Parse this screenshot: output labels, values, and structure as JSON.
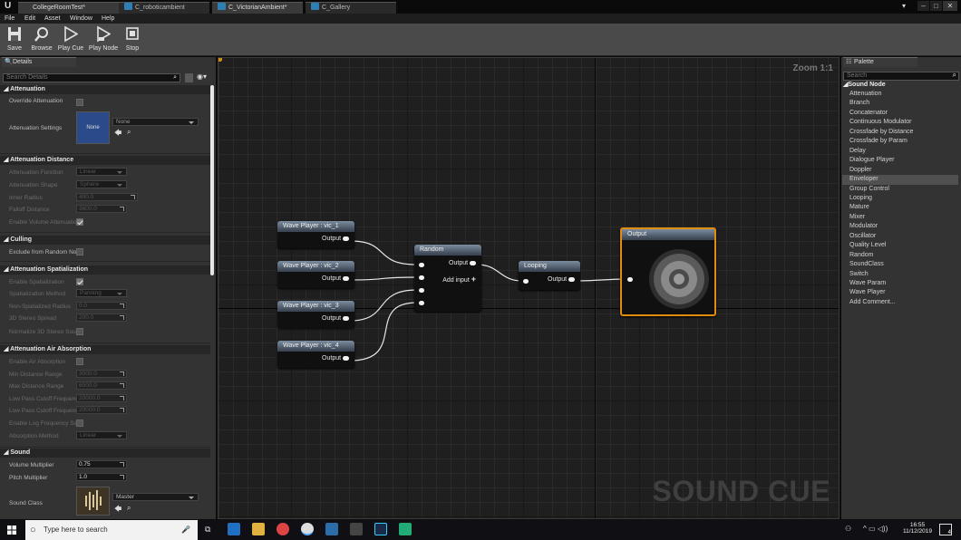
{
  "titlebar": {
    "tabs": [
      "CollegeRoomTest*",
      "C_roboticambient",
      "C_VictorianAmbient*",
      "C_Gallery"
    ],
    "window_buttons": [
      "minimize",
      "maximize",
      "close"
    ]
  },
  "menubar": {
    "items": [
      "File",
      "Edit",
      "Asset",
      "Window",
      "Help"
    ]
  },
  "toolbar": {
    "save": "Save",
    "browse": "Browse",
    "play_cue": "Play Cue",
    "play_node": "Play Node",
    "stop": "Stop"
  },
  "details": {
    "tab_label": "Details",
    "search_placeholder": "Search Details",
    "sections": {
      "attenuation": "Attenuation",
      "attenuation_distance": "Attenuation Distance",
      "culling": "Culling",
      "attenuation_spatialization": "Attenuation Spatialization",
      "air_absorption": "Attenuation Air Absorption",
      "sound": "Sound"
    },
    "rows": {
      "override_attenuation": "Override Attenuation",
      "attenuation_settings": "Attenuation Settings",
      "attenuation_settings_thumb": "None",
      "attenuation_settings_value": "None",
      "attenuation_function": "Attenuation Function",
      "attenuation_function_value": "Linear",
      "attenuation_shape": "Attenuation Shape",
      "attenuation_shape_value": "Sphere",
      "inner_radius": "Inner Radius",
      "inner_radius_value": "400.0",
      "falloff_distance": "Falloff Distance",
      "falloff_distance_value": "3600.0",
      "enable_volume_attenuation": "Enable Volume Attenuatio",
      "exclude_from_random": "Exclude from Random No",
      "enable_spatialization": "Enable Spatialization",
      "spatialization_method": "Spatialization Method",
      "spatialization_method_value": "Panning",
      "non_spatialized_radius": "Non-Spatialized Radius",
      "non_spatialized_radius_value": "0.0",
      "stereo_spread": "3D Stereo Spread",
      "stereo_spread_value": "200.0",
      "normalize_stereo": "Normalize 3D Stereo Sou",
      "enable_air_absorption": "Enable Air Absorption",
      "min_distance_range": "Min Distance Range",
      "min_distance_range_value": "3000.0",
      "max_distance_range": "Max Distance Range",
      "max_distance_range_value": "6000.0",
      "low_pass_min": "Low Pass Cutoff Frequenc",
      "low_pass_min_value": "20000.0",
      "low_pass_max": "Low Pass Cutoff Frequenc",
      "low_pass_max_value": "20000.0",
      "enable_log_freq": "Enable Log Frequency Sc",
      "absorption_method": "Absorption Method",
      "absorption_method_value": "Linear",
      "volume_multiplier": "Volume Multiplier",
      "volume_multiplier_value": "0.75",
      "pitch_multiplier": "Pitch Multiplier",
      "pitch_multiplier_value": "1.0",
      "sound_class": "Sound Class",
      "sound_class_value": "Master"
    }
  },
  "graph": {
    "zoom": "Zoom 1:1",
    "watermark": "SOUND CUE",
    "nodes": {
      "wave1": {
        "title": "Wave Player : vic_1",
        "pin": "Output"
      },
      "wave2": {
        "title": "Wave Player : vic_2",
        "pin": "Output"
      },
      "wave3": {
        "title": "Wave Player : vic_3",
        "pin": "Output"
      },
      "wave4": {
        "title": "Wave Player : vic_4",
        "pin": "Output"
      },
      "random": {
        "title": "Random",
        "pin": "Output",
        "add_input": "Add input"
      },
      "looping": {
        "title": "Looping",
        "pin": "Output"
      },
      "output": {
        "title": "Output"
      }
    }
  },
  "palette": {
    "tab_label": "Palette",
    "search_placeholder": "Search",
    "category": "Sound Node",
    "items": [
      "Attenuation",
      "Branch",
      "Concatenator",
      "Continuous Modulator",
      "Crossfade by Distance",
      "Crossfade by Param",
      "Delay",
      "Dialogue Player",
      "Doppler",
      "Enveloper",
      "Group Control",
      "Looping",
      "Mature",
      "Mixer",
      "Modulator",
      "Oscillator",
      "Quality Level",
      "Random",
      "SoundClass",
      "Switch",
      "Wave Param",
      "Wave Player",
      "Add Comment..."
    ],
    "selected": "Enveloper"
  },
  "taskbar": {
    "search_placeholder": "Type here to search",
    "time": "16:55",
    "date": "11/12/2019",
    "notification_count": "4"
  }
}
